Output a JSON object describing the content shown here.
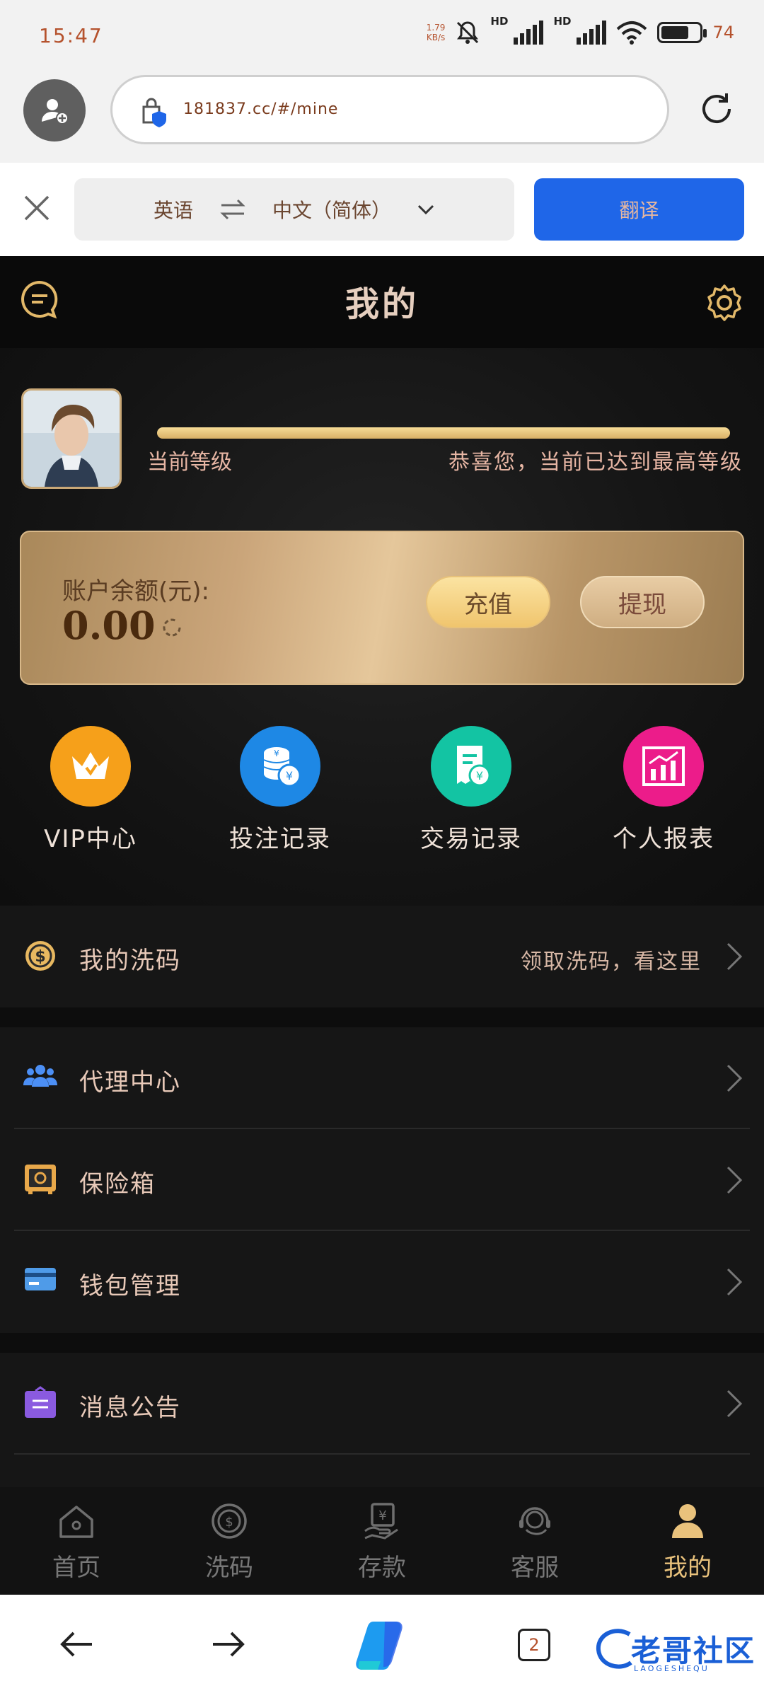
{
  "status_bar": {
    "time": "15:47",
    "net_speed_value": "1.79",
    "net_speed_unit": "KB/s",
    "hd1": "HD",
    "hd2": "HD",
    "battery_percent": "74"
  },
  "browser": {
    "url": "181837.cc/#/mine"
  },
  "translate_bar": {
    "source_lang": "英语",
    "target_lang": "中文（简体）",
    "translate_button": "翻译"
  },
  "header": {
    "title": "我的"
  },
  "profile": {
    "level_label": "当前等级",
    "level_message": "恭喜您，当前已达到最高等级",
    "level_progress": 1.0
  },
  "balance": {
    "label": "账户余额(元):",
    "value": "0.00",
    "recharge_label": "充值",
    "withdraw_label": "提现"
  },
  "quick_actions": [
    {
      "label": "VIP中心",
      "icon": "crown-icon",
      "color": "#f6a01a"
    },
    {
      "label": "投注记录",
      "icon": "coins-icon",
      "color": "#1e88e5"
    },
    {
      "label": "交易记录",
      "icon": "receipt-icon",
      "color": "#13c4a3"
    },
    {
      "label": "个人报表",
      "icon": "report-chart-icon",
      "color": "#ec1c8a"
    }
  ],
  "menu": {
    "rebate": {
      "label": "我的洗码",
      "hint": "领取洗码，看这里"
    },
    "agent": {
      "label": "代理中心"
    },
    "safe": {
      "label": "保险箱"
    },
    "wallet": {
      "label": "钱包管理"
    },
    "notice": {
      "label": "消息公告"
    }
  },
  "bottom_nav": [
    {
      "label": "首页",
      "icon": "home-icon"
    },
    {
      "label": "洗码",
      "icon": "rebate-icon"
    },
    {
      "label": "存款",
      "icon": "deposit-icon"
    },
    {
      "label": "客服",
      "icon": "support-icon"
    },
    {
      "label": "我的",
      "icon": "user-icon",
      "active": true
    }
  ],
  "system_nav": {
    "tab_count": "2",
    "watermark": "老哥社区",
    "watermark_sub": "LAOGESHEQU"
  },
  "colors": {
    "gold": "#e9c27c",
    "translate_blue": "#1f66e8",
    "background": "#0d0d0d"
  }
}
